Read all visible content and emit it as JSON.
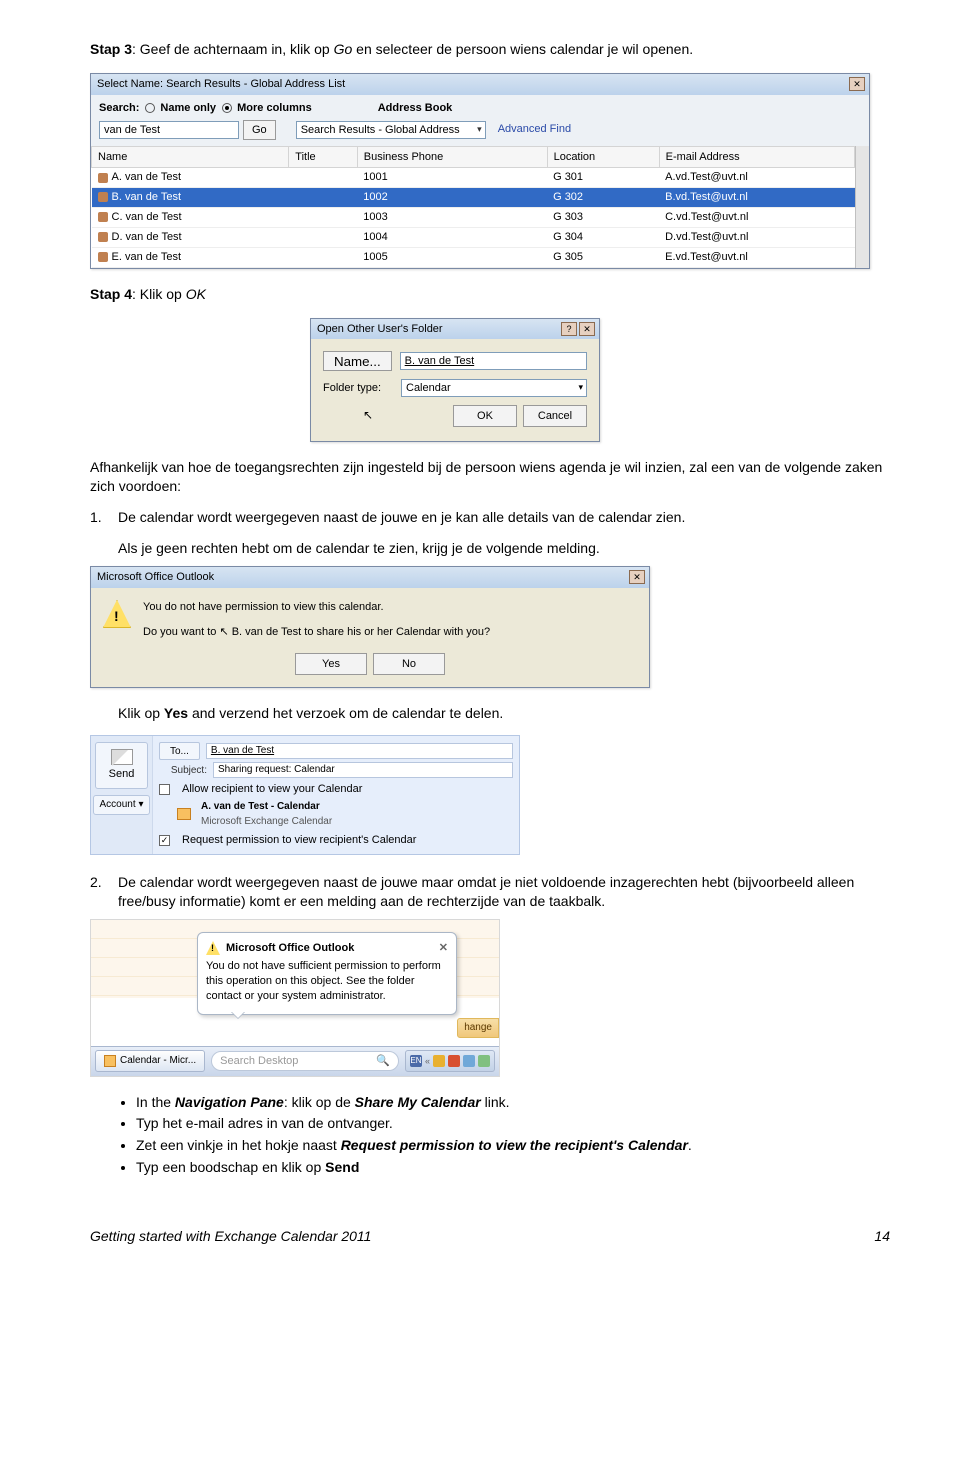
{
  "step3": {
    "label": "Stap 3",
    "text_before_go": ":  Geef de achternaam in, klik op ",
    "go": "Go",
    "text_after_go": " en selecteer de persoon wiens calendar je wil openen."
  },
  "shot1": {
    "title": "Select Name: Search Results - Global Address List",
    "search_label": "Search:",
    "radio1": "Name only",
    "radio2": "More columns",
    "ab_label": "Address Book",
    "input_value": "van de Test",
    "go_btn": "Go",
    "dropdown": "Search Results - Global Address",
    "adv": "Advanced Find",
    "cols": [
      "Name",
      "Title",
      "Business Phone",
      "Location",
      "E-mail Address"
    ],
    "rows": [
      {
        "name": "A. van de Test",
        "phone": "1001",
        "loc": "G 301",
        "mail": "A.vd.Test@uvt.nl"
      },
      {
        "name": "B. van de Test",
        "phone": "1002",
        "loc": "G 302",
        "mail": "B.vd.Test@uvt.nl"
      },
      {
        "name": "C. van de Test",
        "phone": "1003",
        "loc": "G 303",
        "mail": "C.vd.Test@uvt.nl"
      },
      {
        "name": "D. van de Test",
        "phone": "1004",
        "loc": "G 304",
        "mail": "D.vd.Test@uvt.nl"
      },
      {
        "name": "E. van de Test",
        "phone": "1005",
        "loc": "G 305",
        "mail": "E.vd.Test@uvt.nl"
      }
    ]
  },
  "step4": {
    "label": "Stap 4",
    "text_before_ok": ":  Klik op ",
    "ok": "OK"
  },
  "shot2": {
    "title": "Open Other User's Folder",
    "name_btn": "Name...",
    "name_val": "B. van de Test",
    "folder_label": "Folder type:",
    "folder_val": "Calendar",
    "ok": "OK",
    "cancel": "Cancel"
  },
  "para_afh": "Afhankelijk van hoe de toegangsrechten zijn ingesteld bij de persoon wiens agenda je wil inzien, zal een van de volgende zaken zich voordoen:",
  "num1": {
    "n": "1.",
    "line1": "De calendar wordt weergegeven naast de jouwe en je kan alle details van de calendar zien.",
    "line2": "Als je geen rechten hebt om de calendar te zien, krijg je de volgende melding."
  },
  "shot3": {
    "title": "Microsoft Office Outlook",
    "msg1": "You do not have permission to view this calendar.",
    "msg2_a": "Do you want to ",
    "msg2_b": " B. van de Test to share his or her Calendar with you?",
    "yes": "Yes",
    "no": "No"
  },
  "klik_yes": {
    "a": "Klik op ",
    "b": "Yes",
    "c": " and verzend het verzoek om de calendar te delen."
  },
  "shot4": {
    "send": "Send",
    "account": "Account",
    "to_btn": "To...",
    "to_val": "B. van de Test",
    "subject_lbl": "Subject:",
    "subject_val": "Sharing request: Calendar",
    "chk1": "Allow recipient to view your Calendar",
    "cal_owner": "A. van de Test - Calendar",
    "cal_type": "Microsoft Exchange Calendar",
    "chk2": "Request permission to view recipient's Calendar"
  },
  "num2": {
    "n": "2.",
    "text": "De calendar wordt weergegeven naast de jouwe maar omdat je niet voldoende inzagerechten hebt (bijvoorbeeld alleen free/busy informatie) komt er een melding aan de rechterzijde van de taakbalk."
  },
  "shot5": {
    "b_title": "Microsoft Office Outlook",
    "b_msg": "You do not have sufficient permission to perform this operation on this object.  See the folder contact or your system administrator.",
    "exchange": "hange",
    "task": "Calendar - Micr...",
    "search_ph": "Search Desktop",
    "tray_en": "EN"
  },
  "bullets": {
    "b1a": "In the ",
    "b1b": "Navigation Pane",
    "b1c": ": klik op de ",
    "b1d": "Share My Calendar",
    "b1e": " link.",
    "b2": "Typ het e-mail adres in van de ontvanger.",
    "b3a": "Zet een vinkje in het hokje naast ",
    "b3b": "Request permission to view the recipient's Calendar",
    "b3c": ".",
    "b4a": "Typ een boodschap en klik op ",
    "b4b": "Send"
  },
  "footer": {
    "left": "Getting started with Exchange Calendar 2011",
    "right": "14"
  }
}
